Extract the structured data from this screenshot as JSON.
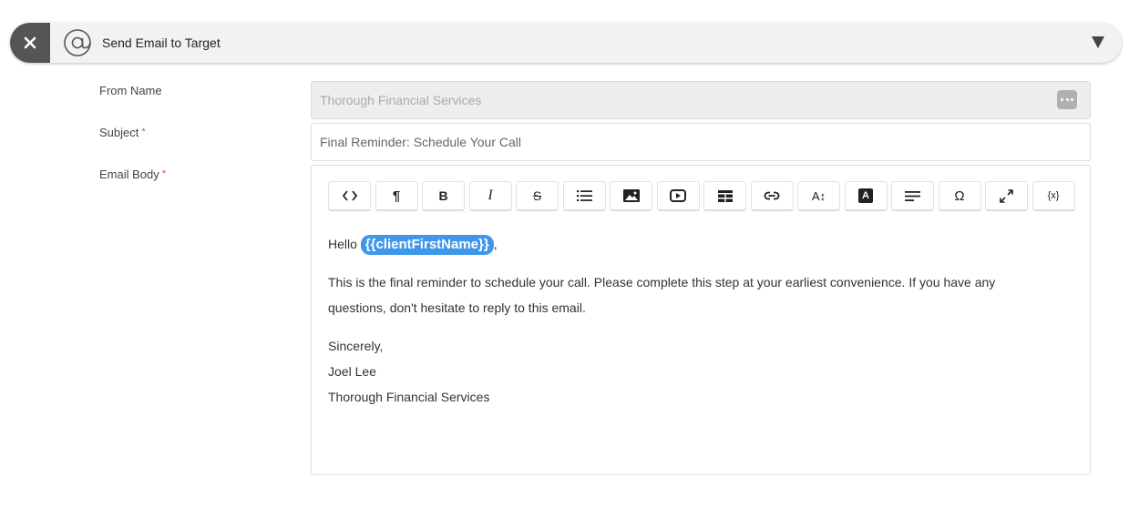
{
  "header": {
    "title": "Send Email to Target",
    "close_label": "X"
  },
  "form": {
    "from_name": {
      "label": "From Name",
      "value": "Thorough Financial Services"
    },
    "subject": {
      "label": "Subject",
      "required_mark": "*",
      "value": "Final Reminder: Schedule Your Call"
    },
    "email_body": {
      "label": "Email Body",
      "required_mark": "*"
    }
  },
  "toolbar": {
    "buttons": [
      {
        "name": "code-view",
        "glyph": "<>"
      },
      {
        "name": "paragraph",
        "glyph": "¶"
      },
      {
        "name": "bold",
        "glyph": "B"
      },
      {
        "name": "italic",
        "glyph": "I"
      },
      {
        "name": "strikethrough",
        "glyph": "S"
      },
      {
        "name": "unordered-list",
        "glyph": ""
      },
      {
        "name": "image",
        "glyph": ""
      },
      {
        "name": "video",
        "glyph": ""
      },
      {
        "name": "table",
        "glyph": ""
      },
      {
        "name": "link",
        "glyph": ""
      },
      {
        "name": "font-size",
        "glyph": "A↕"
      },
      {
        "name": "font-color",
        "glyph": "A"
      },
      {
        "name": "align",
        "glyph": ""
      },
      {
        "name": "special-character",
        "glyph": "Ω"
      },
      {
        "name": "fullscreen",
        "glyph": ""
      },
      {
        "name": "insert-variable",
        "glyph": "{x}"
      }
    ]
  },
  "body": {
    "greeting": "Hello",
    "variable": "{{clientFirstName}}",
    "greeting_suffix": ",",
    "paragraph": "This is the final reminder to schedule your call. Please complete this step at your earliest convenience. If you have any questions, don't hesitate to reply to this email.",
    "closing": "Sincerely,",
    "signature_name": "Joel Lee",
    "signature_company": "Thorough Financial Services"
  },
  "colors": {
    "variable_chip": "#3f97ea",
    "required": "#d9534f",
    "close_button": "#555555"
  }
}
